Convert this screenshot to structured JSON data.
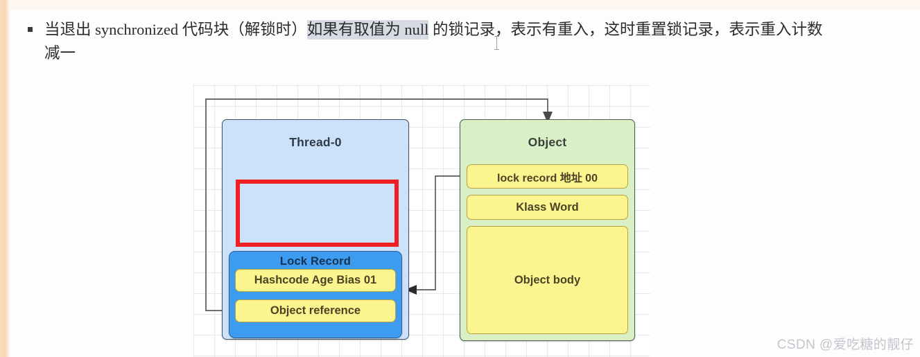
{
  "document": {
    "paragraph": {
      "bullet_glyph": "square-bullet",
      "prefix": "当退出 synchronized 代码块（解锁时）",
      "selected": "如果有取值为 null",
      "suffix": " 的锁记录，表示有重入，这时重置锁记录，表示重入计数减一"
    }
  },
  "diagram": {
    "thread": {
      "title": "Thread-0",
      "fill": "#cbe2fa",
      "lock_record": {
        "title": "Lock Record",
        "fill": "#3d9cf0",
        "slots": [
          "Hashcode Age Bias 01",
          "Object reference"
        ]
      },
      "crossed_slot": {
        "label": "",
        "stroke": "#ef1f22"
      }
    },
    "object": {
      "title": "Object",
      "fill": "#d9efc6",
      "slots": [
        "lock record 地址 00",
        "Klass Word",
        "Object body"
      ]
    },
    "colors": {
      "yellow_slot": "#fbf58f",
      "border": "#44505e",
      "red": "#ef1f22",
      "grid": "#e9e9e9"
    }
  },
  "watermark": {
    "text": "CSDN @爱吃糖的靓仔"
  }
}
